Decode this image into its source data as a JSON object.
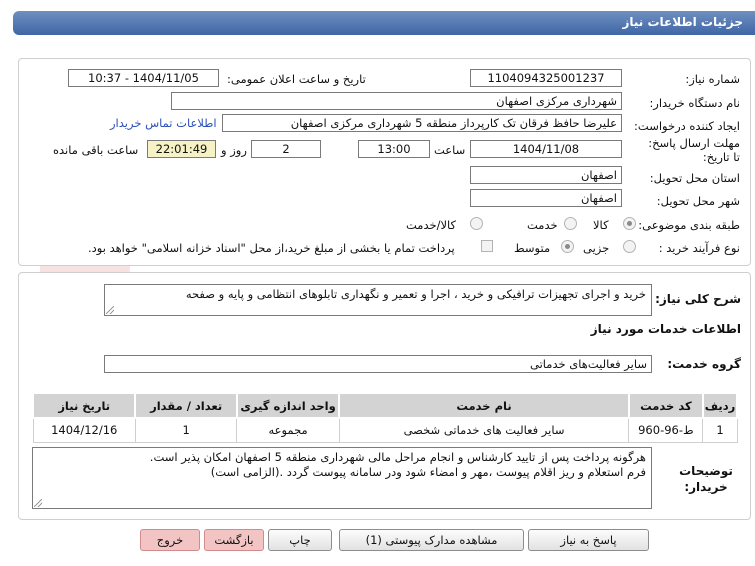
{
  "header": {
    "title": "جزئیات اطلاعات نیاز"
  },
  "fields": {
    "need_number_label": "شماره نیاز:",
    "need_number": "1104094325001237",
    "announce_label": "تاریخ و ساعت اعلان عمومی:",
    "announce_value": "1404/11/05 - 10:37",
    "buyer_org_label": "نام دستگاه خریدار:",
    "buyer_org": "شهرداری مرکزی اصفهان",
    "requester_label": "ایجاد کننده درخواست:",
    "requester": "علیرضا حافظ فرقان تک کارپرداز منطقه 5 شهرداری مرکزی اصفهان",
    "contact_link": "اطلاعات تماس خریدار",
    "deadline_label": "مهلت ارسال پاسخ: تا تاریخ:",
    "deadline_date": "1404/11/08",
    "time_label": "ساعت",
    "deadline_time": "13:00",
    "days_value": "2",
    "days_label": "روز و",
    "remaining_time": "22:01:49",
    "remaining_label": "ساعت باقی مانده",
    "province_label": "استان محل تحویل:",
    "province": "اصفهان",
    "city_label": "شهر محل تحویل:",
    "city": "اصفهان",
    "category_label": "طبقه بندی موضوعی:",
    "category_options": [
      "کالا",
      "خدمت",
      "کالا/خدمت"
    ],
    "process_label": "نوع فرآیند خرید :",
    "process_options": [
      "جزیی",
      "متوسط"
    ],
    "payment_note": "پرداخت تمام یا بخشی از مبلغ خرید،از محل \"اسناد خزانه اسلامی\" خواهد بود."
  },
  "description": {
    "label": "شرح کلی نیاز:",
    "value": "خرید و اجرای تجهیزات ترافیکی و خرید ، اجرا و تعمیر و نگهداری تابلوهای انتظامی و پایه و صفحه"
  },
  "services": {
    "section_title": "اطلاعات خدمات مورد نیاز",
    "group_label": "گروه خدمت:",
    "group_value": "سایر فعالیت‌های خدماتی",
    "columns": [
      "ردیف",
      "کد خدمت",
      "نام خدمت",
      "واحد اندازه گیری",
      "تعداد / مقدار",
      "تاریخ نیاز"
    ],
    "rows": [
      [
        "1",
        "ط-96-960",
        "سایر فعالیت های خدماتی شخصی",
        "مجموعه",
        "1",
        "1404/12/16"
      ]
    ]
  },
  "buyer_notes": {
    "label": "توضیحات خریدار:",
    "line1": "هرگونه پرداخت پس از تایید کارشناس و انجام مراحل مالی شهرداری منطقه 5 اصفهان  امکان پذیر است.",
    "line2": "فرم استعلام و ریز اقلام پیوست ،مهر و امضاء شود ودر سامانه پیوست گردد .(الزامی است)"
  },
  "buttons": {
    "reply": "پاسخ به نیاز",
    "attachments": "مشاهده مدارک پیوستی (1)",
    "print": "چاپ",
    "back": "بازگشت",
    "exit": "خروج"
  },
  "watermark": {
    "brand": "AriaTender.net"
  },
  "colors": {
    "header": "#4a6fae",
    "link": "#2b4fb8",
    "table_header": "#d3d3d3",
    "exit_button": "#f3c4c4"
  }
}
